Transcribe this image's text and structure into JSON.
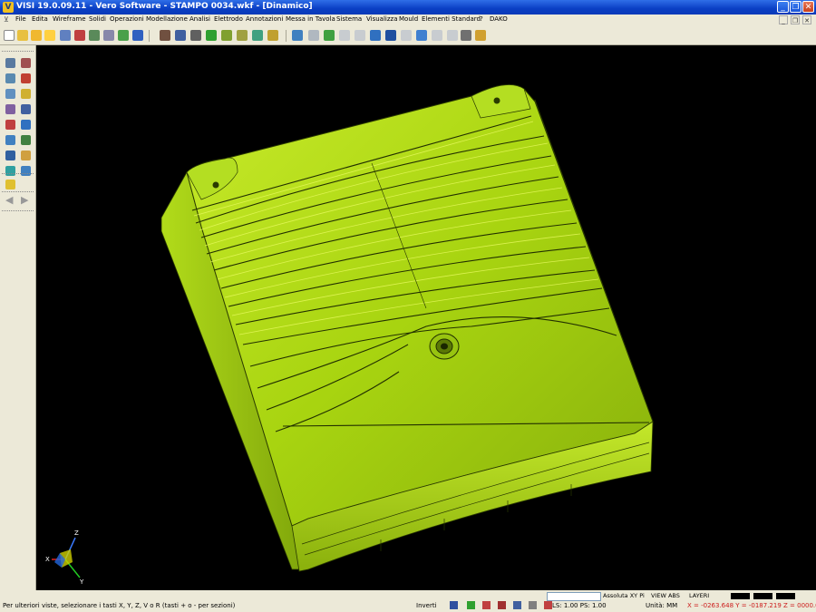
{
  "window": {
    "title": "VISI 19.0.09.11 - Vero Software - STAMPO 0034.wkf - [Dinamico]",
    "app_icon": "V",
    "controls": [
      "_",
      "❐",
      "✕"
    ]
  },
  "menu": {
    "items": [
      "File",
      "Edita",
      "Wireframe",
      "Solidi",
      "Operazioni",
      "Modellazione",
      "Analisi",
      "Elettrodo",
      "Annotazioni",
      "Messa in Tavola",
      "Sistema",
      "Visualizza",
      "Mould",
      "Elementi Standard",
      "?",
      "DAKO"
    ],
    "mdi_controls": [
      "_",
      "❐",
      "✕"
    ]
  },
  "axes": {
    "z": "Z",
    "x": "X",
    "y": "Y"
  },
  "status": {
    "hint": "Per ulteriori viste, selezionare i tasti X, Y, Z, V o R (tasti  + o - per sezioni)",
    "invert": "Inverti",
    "view_label": "Assoluta XY Pi",
    "view_abs": "VIEW ABS",
    "layer": "LAYERI",
    "ls_ps": "LS: 1.00 PS: 1.00",
    "units": "Unità: MM",
    "coords": "X = -0263.648 Y = -0187.219 Z = 0000.000"
  },
  "colors": {
    "part_fill": "#a8d410",
    "part_highlight": "#d6f23a",
    "part_shadow": "#6a8a08",
    "background": "#000000",
    "ui_face": "#ece9d8",
    "coords_red": "#cc1a1a"
  },
  "icons": {
    "toolbar": [
      "new-file-icon",
      "open-folder-icon",
      "open-icon",
      "save-icon",
      "print-icon",
      "print-preview-icon",
      "cut-icon",
      "copy-icon",
      "paste-icon",
      "undo-icon",
      "redo-icon",
      "layer-icon",
      "attribute-icon",
      "shade-icon",
      "wire-icon",
      "hidden-icon",
      "section-icon",
      "zoom-icon",
      "pan-icon",
      "rotate-icon",
      "refresh-icon",
      "cylinder-icon",
      "block-icon",
      "cone-icon",
      "sphere-icon",
      "torus-icon",
      "extrude-icon",
      "revolve-icon",
      "sweep-icon",
      "loft-icon",
      "tools-icon",
      "grid-icon"
    ],
    "left": [
      "select-icon",
      "trim-icon",
      "box-icon",
      "delete-icon",
      "measure-icon",
      "edit-icon",
      "point-icon",
      "line-icon",
      "circle-icon",
      "arc-icon",
      "move-icon",
      "rotate-entity-icon",
      "scale-icon",
      "mirror-icon",
      "light-icon",
      "render-icon",
      "hat-icon",
      "folder-icon",
      "back-arrow-icon",
      "forward-arrow-icon"
    ]
  }
}
